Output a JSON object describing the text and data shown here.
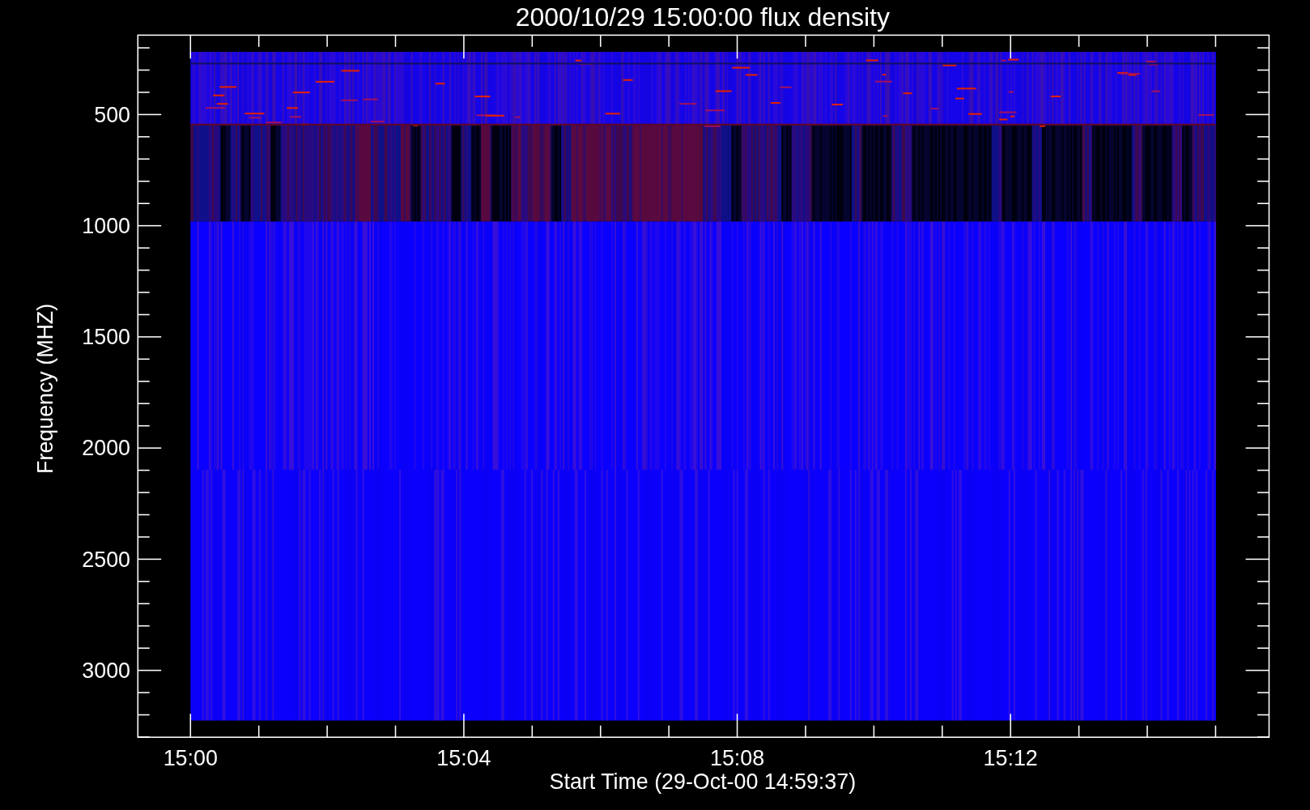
{
  "title": "2000/10/29 15:00:00 flux density",
  "y_axis": {
    "label": "Frequency (MHZ)",
    "ticks": [
      "500",
      "1000",
      "1500",
      "2000",
      "2500",
      "3000"
    ]
  },
  "x_axis": {
    "label": "Start Time (29-Oct-00 14:59:37)",
    "ticks": [
      "15:00",
      "15:04",
      "15:08",
      "15:12"
    ]
  }
}
